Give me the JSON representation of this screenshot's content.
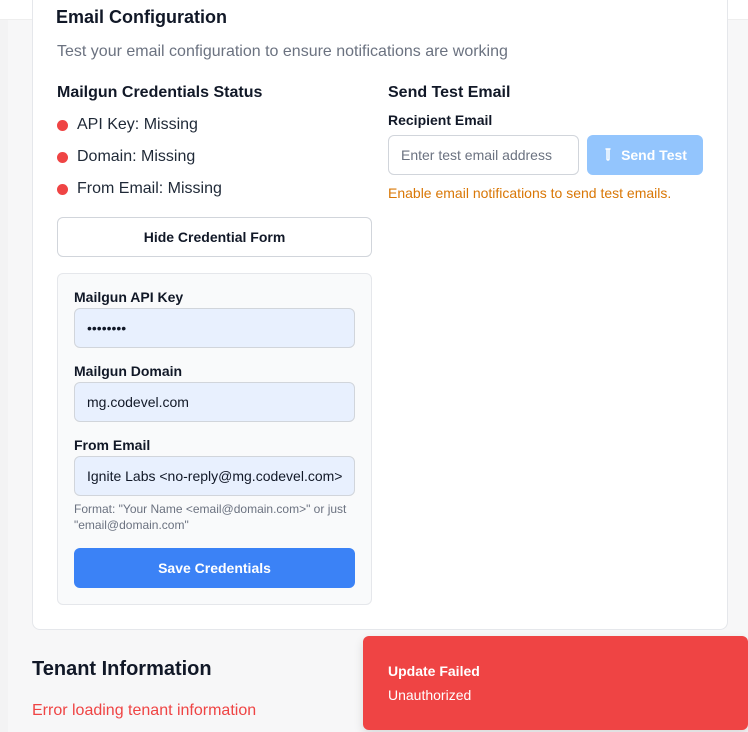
{
  "card": {
    "title": "Email Configuration",
    "description": "Test your email configuration to ensure notifications are working"
  },
  "credentials_status": {
    "heading": "Mailgun Credentials Status",
    "items": [
      {
        "label": "API Key: Missing",
        "status_color": "#ef4444"
      },
      {
        "label": "Domain: Missing",
        "status_color": "#ef4444"
      },
      {
        "label": "From Email: Missing",
        "status_color": "#ef4444"
      }
    ],
    "toggle_label": "Hide Credential Form"
  },
  "credential_form": {
    "api_key_label": "Mailgun API Key",
    "api_key_value": "••••••••",
    "domain_label": "Mailgun Domain",
    "domain_value": "mg.codevel.com",
    "from_label": "From Email",
    "from_value": "Ignite Labs <no-reply@mg.codevel.com>",
    "format_hint": "Format: \"Your Name <email@domain.com>\" or just \"email@domain.com\"",
    "save_label": "Save Credentials"
  },
  "test_email": {
    "heading": "Send Test Email",
    "recipient_label": "Recipient Email",
    "recipient_placeholder": "Enter test email address",
    "send_label": "Send Test",
    "send_icon": "test-tube-icon",
    "warning": "Enable email notifications to send test emails."
  },
  "tenant": {
    "title": "Tenant Information",
    "error": "Error loading tenant information"
  },
  "toast": {
    "title": "Update Failed",
    "message": "Unauthorized",
    "color": "#ef4444"
  },
  "colors": {
    "accent": "#3b82f6",
    "accent_disabled": "#93c5fd",
    "error": "#ef4444",
    "warning": "#d97706"
  }
}
